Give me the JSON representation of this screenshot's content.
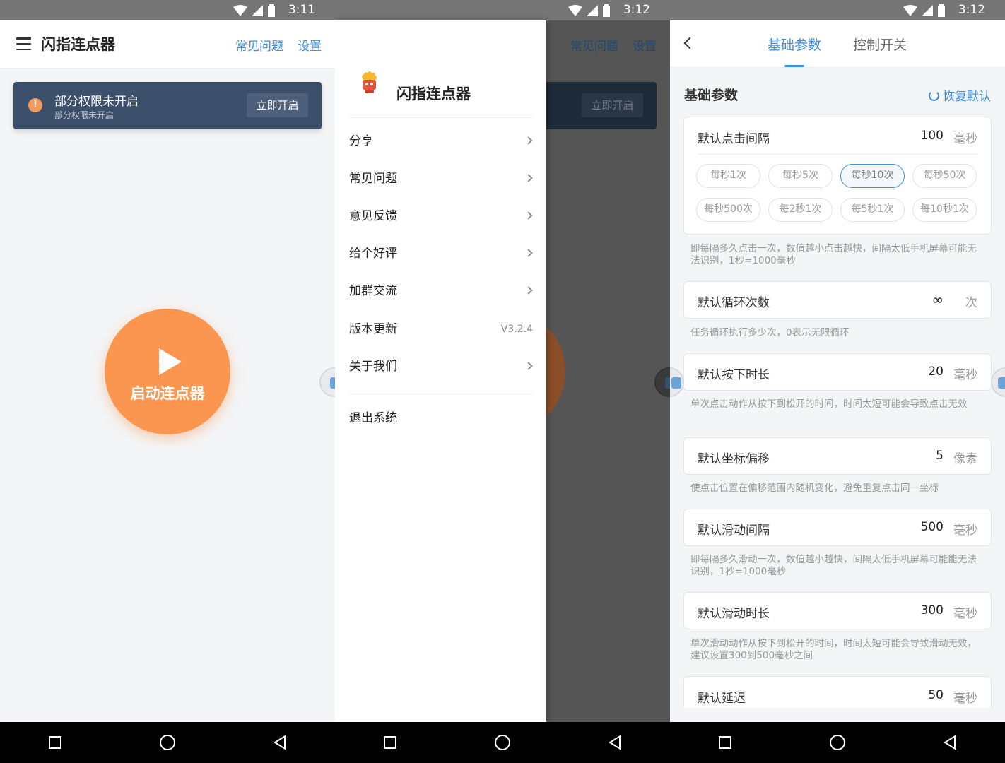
{
  "status": {
    "time_left": "3:11",
    "time_mid": "3:12",
    "time_right": "3:12"
  },
  "app": {
    "title": "闪指连点器",
    "faq_link": "常见问题",
    "settings_link": "设置"
  },
  "warning": {
    "title": "部分权限未开启",
    "subtitle": "部分权限未开启",
    "action": "立即开启",
    "icon": "alert-icon"
  },
  "start": {
    "label": "启动连点器",
    "icon": "play-icon"
  },
  "drawer": {
    "title": "闪指连点器",
    "items": [
      {
        "label": "分享"
      },
      {
        "label": "常见问题"
      },
      {
        "label": "意见反馈"
      },
      {
        "label": "给个好评"
      },
      {
        "label": "加群交流"
      },
      {
        "label": "版本更新",
        "value": "V3.2.4"
      },
      {
        "label": "关于我们"
      }
    ],
    "logout": "退出系统"
  },
  "settings": {
    "tabs": [
      {
        "label": "基础参数",
        "active": true
      },
      {
        "label": "控制开关",
        "active": false
      }
    ],
    "section_title": "基础参数",
    "reset": "恢复默认",
    "interval": {
      "label": "默认点击间隔",
      "value": "100",
      "unit": "毫秒",
      "chips": [
        "每秒1次",
        "每秒5次",
        "每秒10次",
        "每秒50次",
        "每秒500次",
        "每2秒1次",
        "每5秒1次",
        "每10秒1次"
      ],
      "selected_chip": "每秒10次",
      "hint": "即每隔多久点击一次，数值越小点击越快，间隔太低手机屏幕可能无法识别，1秒=1000毫秒"
    },
    "rows": [
      {
        "label": "默认循环次数",
        "value": "∞",
        "unit": "次",
        "hint": "任务循环执行多少次，0表示无限循环"
      },
      {
        "label": "默认按下时长",
        "value": "20",
        "unit": "毫秒",
        "hint": "单次点击动作从按下到松开的时间，时间太短可能会导致点击无效"
      },
      {
        "label": "默认坐标偏移",
        "value": "5",
        "unit": "像素",
        "hint": "使点击位置在偏移范围内随机变化，避免重复点击同一坐标"
      },
      {
        "label": "默认滑动间隔",
        "value": "500",
        "unit": "毫秒",
        "hint": "即每隔多久滑动一次，数值越小越快，间隔太低手机屏幕可能能无法识别，1秒=1000毫秒"
      },
      {
        "label": "默认滑动时长",
        "value": "300",
        "unit": "毫秒",
        "hint": "单次滑动动作从按下到松开的时间，时间太短可能会导致滑动无效，建议设置300到500毫秒之间"
      },
      {
        "label": "默认延迟",
        "value": "50",
        "unit": "毫秒",
        "hint": ""
      }
    ]
  },
  "colors": {
    "accent": "#3f8edc",
    "start_button": "#fb9650",
    "warning_bg": "#3c4f6b"
  }
}
